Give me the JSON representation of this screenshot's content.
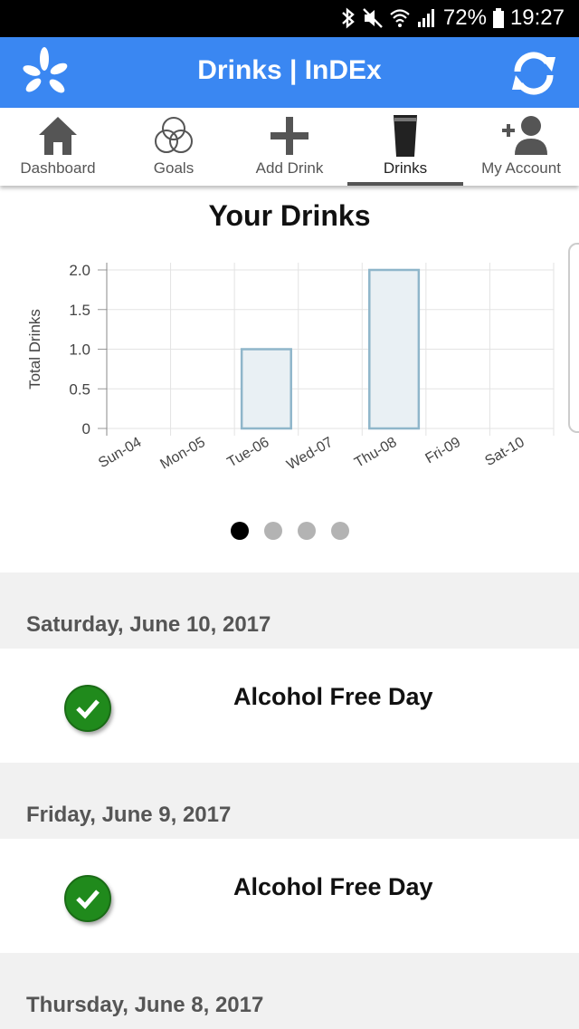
{
  "status_bar": {
    "battery": "72%",
    "time": "19:27"
  },
  "app_bar": {
    "title": "Drinks | InDEx"
  },
  "tabs": [
    {
      "label": "Dashboard",
      "icon": "home-icon",
      "active": false
    },
    {
      "label": "Goals",
      "icon": "goals-circles-icon",
      "active": false
    },
    {
      "label": "Add Drink",
      "icon": "plus-icon",
      "active": false
    },
    {
      "label": "Drinks",
      "icon": "pint-glass-icon",
      "active": true
    },
    {
      "label": "My Account",
      "icon": "add-person-icon",
      "active": false
    }
  ],
  "chart_heading": "Your Drinks",
  "chart_data": {
    "type": "bar",
    "categories": [
      "Sun-04",
      "Mon-05",
      "Tue-06",
      "Wed-07",
      "Thu-08",
      "Fri-09",
      "Sat-10"
    ],
    "values": [
      0,
      0,
      1,
      0,
      2,
      0,
      0
    ],
    "ylabel": "Total Drinks",
    "xlabel": "",
    "ylim": [
      0,
      2
    ],
    "yticks": [
      "2.0",
      "1.5",
      "1.0",
      "0.5",
      "0"
    ],
    "ytick_values": [
      2,
      1.5,
      1,
      0.5,
      0
    ],
    "grid": true,
    "bar_fill": "#e9f0f4",
    "bar_stroke": "#8fb6ca"
  },
  "carousel": {
    "pages": 4,
    "active_index": 0
  },
  "days": [
    {
      "date": "Saturday, June 10, 2017",
      "entry": "Alcohol Free Day"
    },
    {
      "date": "Friday, June 9, 2017",
      "entry": "Alcohol Free Day"
    },
    {
      "date": "Thursday, June 8, 2017",
      "entry": null
    }
  ],
  "colors": {
    "app_bar": "#3a87f2",
    "check": "#208a1c"
  }
}
